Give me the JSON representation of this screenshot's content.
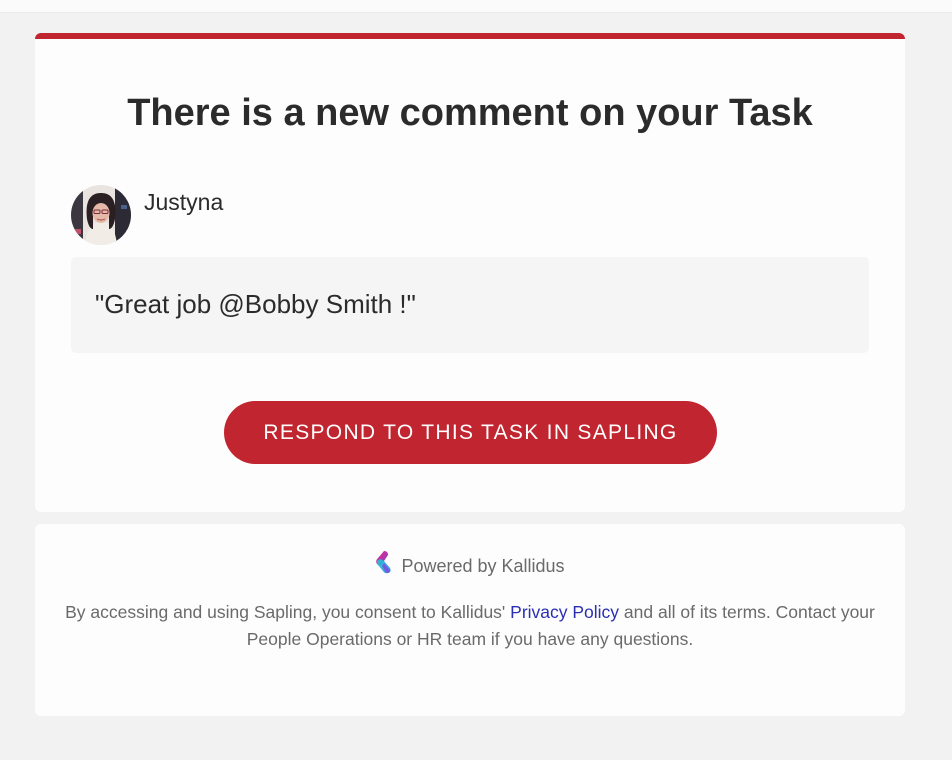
{
  "email": {
    "title": "There is a new comment on your Task",
    "comment": {
      "author": "Justyna",
      "text": "\"Great job @Bobby Smith !\""
    },
    "cta_label": "RESPOND TO THIS TASK IN SAPLING"
  },
  "footer": {
    "powered_by": "Powered by Kallidus",
    "legal_before": "By accessing and using Sapling, you consent to Kallidus' ",
    "privacy_link": "Privacy Policy",
    "legal_after": " and all of its terms. Contact your People Operations or HR team if you have any questions."
  },
  "colors": {
    "accent": "#c1252f",
    "link": "#2a2fb3",
    "background": "#f2f2f2",
    "card": "#fdfdfd"
  },
  "icons": {
    "brand_logo": "kallidus-logo-icon",
    "avatar": "user-avatar-photo"
  }
}
